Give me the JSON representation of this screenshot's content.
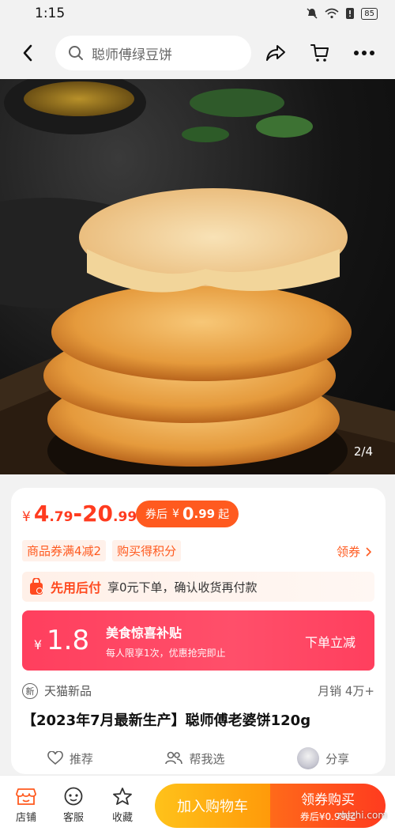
{
  "status_bar": {
    "time": "1:15",
    "battery": "85"
  },
  "header": {
    "search_placeholder": "聪师傅绿豆饼"
  },
  "hero": {
    "counter": "2/4"
  },
  "price": {
    "yen": "¥",
    "low_int": "4",
    "low_dec": ".79",
    "dash": "-",
    "high_int": "20",
    "high_dec": ".99",
    "coupon_label": "券后",
    "coupon_yen": "¥",
    "coupon_int": "0",
    "coupon_dec": ".99",
    "coupon_suffix": "起"
  },
  "tags": [
    "商品券满4减2",
    "购买得积分"
  ],
  "lingquan": "领券",
  "paylater": {
    "title": "先用后付",
    "desc": "享0元下单，确认收货再付款"
  },
  "subsidy": {
    "yen": "¥",
    "amount": "1.8",
    "title": "美食惊喜补贴",
    "subtitle": "每人限享1次，优惠抢完即止",
    "cta": "下单立减"
  },
  "meta": {
    "badge": "新",
    "channel": "天猫新品",
    "sales": "月销 4万+"
  },
  "title": "【2023年7月最新生产】聪师傅老婆饼120g",
  "actions": {
    "recommend": "推荐",
    "help": "帮我选",
    "share": "分享"
  },
  "bottom": {
    "store": "店铺",
    "service": "客服",
    "favorite": "收藏",
    "add_cart": "加入购物车",
    "buy": "领券购买",
    "buy_sub": "券后¥0.99起"
  },
  "watermark": "zhizhi.com",
  "colors": {
    "accent": "#ff5a1f",
    "red": "#ff3b1f",
    "subsidy": "#ff4560",
    "cart": "#ffb20f"
  }
}
